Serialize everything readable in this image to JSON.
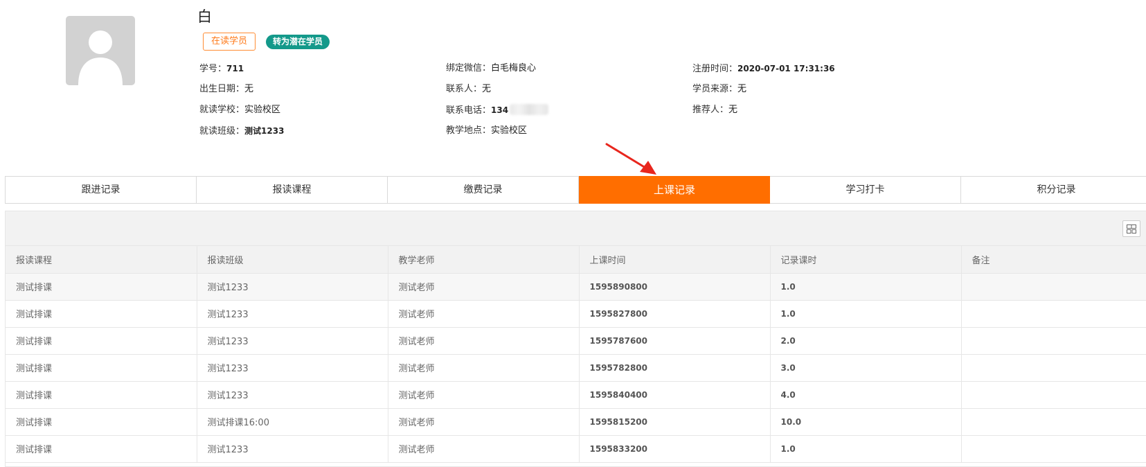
{
  "student": {
    "name": "白",
    "status_tag": "在读学员",
    "convert_button": "转为潜在学员"
  },
  "info": {
    "col1": [
      {
        "label": "学号：",
        "value": "711"
      },
      {
        "label": "出生日期：",
        "value": "无"
      },
      {
        "label": "就读学校：",
        "value": "实验校区"
      },
      {
        "label": "就读班级：",
        "value": "测试1233"
      }
    ],
    "col2": [
      {
        "label": "绑定微信：",
        "value": "白毛梅良心"
      },
      {
        "label": "联系人：",
        "value": "无"
      },
      {
        "label": "联系电话：",
        "value": "134"
      },
      {
        "label": "教学地点：",
        "value": "实验校区"
      }
    ],
    "col3": [
      {
        "label": "注册时间：",
        "value": "2020-07-01 17:31:36"
      },
      {
        "label": "学员来源：",
        "value": "无"
      },
      {
        "label": "推荐人：",
        "value": "无"
      }
    ]
  },
  "tabs": [
    {
      "label": "跟进记录"
    },
    {
      "label": "报读课程"
    },
    {
      "label": "缴费记录"
    },
    {
      "label": "上课记录"
    },
    {
      "label": "学习打卡"
    },
    {
      "label": "积分记录"
    }
  ],
  "active_tab": 3,
  "accent_color": "#ff6e00",
  "convert_color": "#13998a",
  "table": {
    "headers": [
      "报读课程",
      "报读班级",
      "教学老师",
      "上课时间",
      "记录课时",
      "备注"
    ],
    "rows": [
      [
        "测试排课",
        "测试1233",
        "测试老师",
        "1595890800",
        "1.0",
        ""
      ],
      [
        "测试排课",
        "测试1233",
        "测试老师",
        "1595827800",
        "1.0",
        ""
      ],
      [
        "测试排课",
        "测试1233",
        "测试老师",
        "1595787600",
        "2.0",
        ""
      ],
      [
        "测试排课",
        "测试1233",
        "测试老师",
        "1595782800",
        "3.0",
        ""
      ],
      [
        "测试排课",
        "测试1233",
        "测试老师",
        "1595840400",
        "4.0",
        ""
      ],
      [
        "测试排课",
        "测试排课16:00",
        "测试老师",
        "1595815200",
        "10.0",
        ""
      ],
      [
        "测试排课",
        "测试1233",
        "测试老师",
        "1595833200",
        "1.0",
        ""
      ]
    ]
  },
  "icons": {
    "avatar": "user-silhouette-icon",
    "column_toggle": "grid-columns-icon",
    "annotation": "red-arrow-icon"
  }
}
